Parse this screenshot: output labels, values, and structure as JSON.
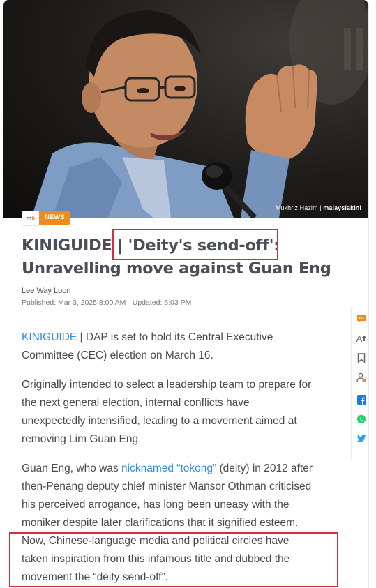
{
  "hero": {
    "credit_name": "Mukhriz Hazim",
    "credit_sep": " | ",
    "credit_brand": "malaysiakini"
  },
  "badges": {
    "logo_m": "m",
    "logo_k": "k",
    "category": "NEWS"
  },
  "article": {
    "headline": "KINIGUIDE | 'Deity's send-off': Unravelling move against Guan Eng",
    "author": "Lee Way Loon",
    "published": "Published:  Mar 3, 2025 8:00 AM · Updated: 6:03 PM",
    "p1_link": "KINIGUIDE",
    "p1_text": " | DAP is set to hold its Central Executive Committee (CEC) election on March 16.",
    "p2_text": "Originally intended to select a leadership team to prepare for the next general election, internal conflicts have unexpectedly intensified, leading to a movement aimed at removing Lim Guan Eng.",
    "p3_start": "Guan Eng, who was ",
    "p3_link": "nicknamed “tokong”",
    "p3_end": " (deity) in 2012 after then-Penang deputy chief minister Mansor Othman criticised his perceived arrogance, has long been uneasy with the moniker despite later clarifications that it signified esteem. Now, Chinese-language media and political circles have taken inspiration from this infamous title and dubbed the movement the “deity send-off”."
  },
  "toolbar": {
    "icons": [
      "comment-icon",
      "font-size-icon",
      "bookmark-icon",
      "gift-user-icon",
      "facebook-icon",
      "whatsapp-icon",
      "twitter-icon"
    ],
    "font_size_label": "A",
    "colors": {
      "comment": "#f08c1e",
      "gray": "#666666",
      "facebook": "#1877f2",
      "whatsapp": "#25d366",
      "twitter": "#1da1f2"
    }
  },
  "colors": {
    "accent": "#f08c1e",
    "link": "#2f8ee6",
    "highlight_box": "#d32f3a",
    "headline": "#4a4f57"
  }
}
